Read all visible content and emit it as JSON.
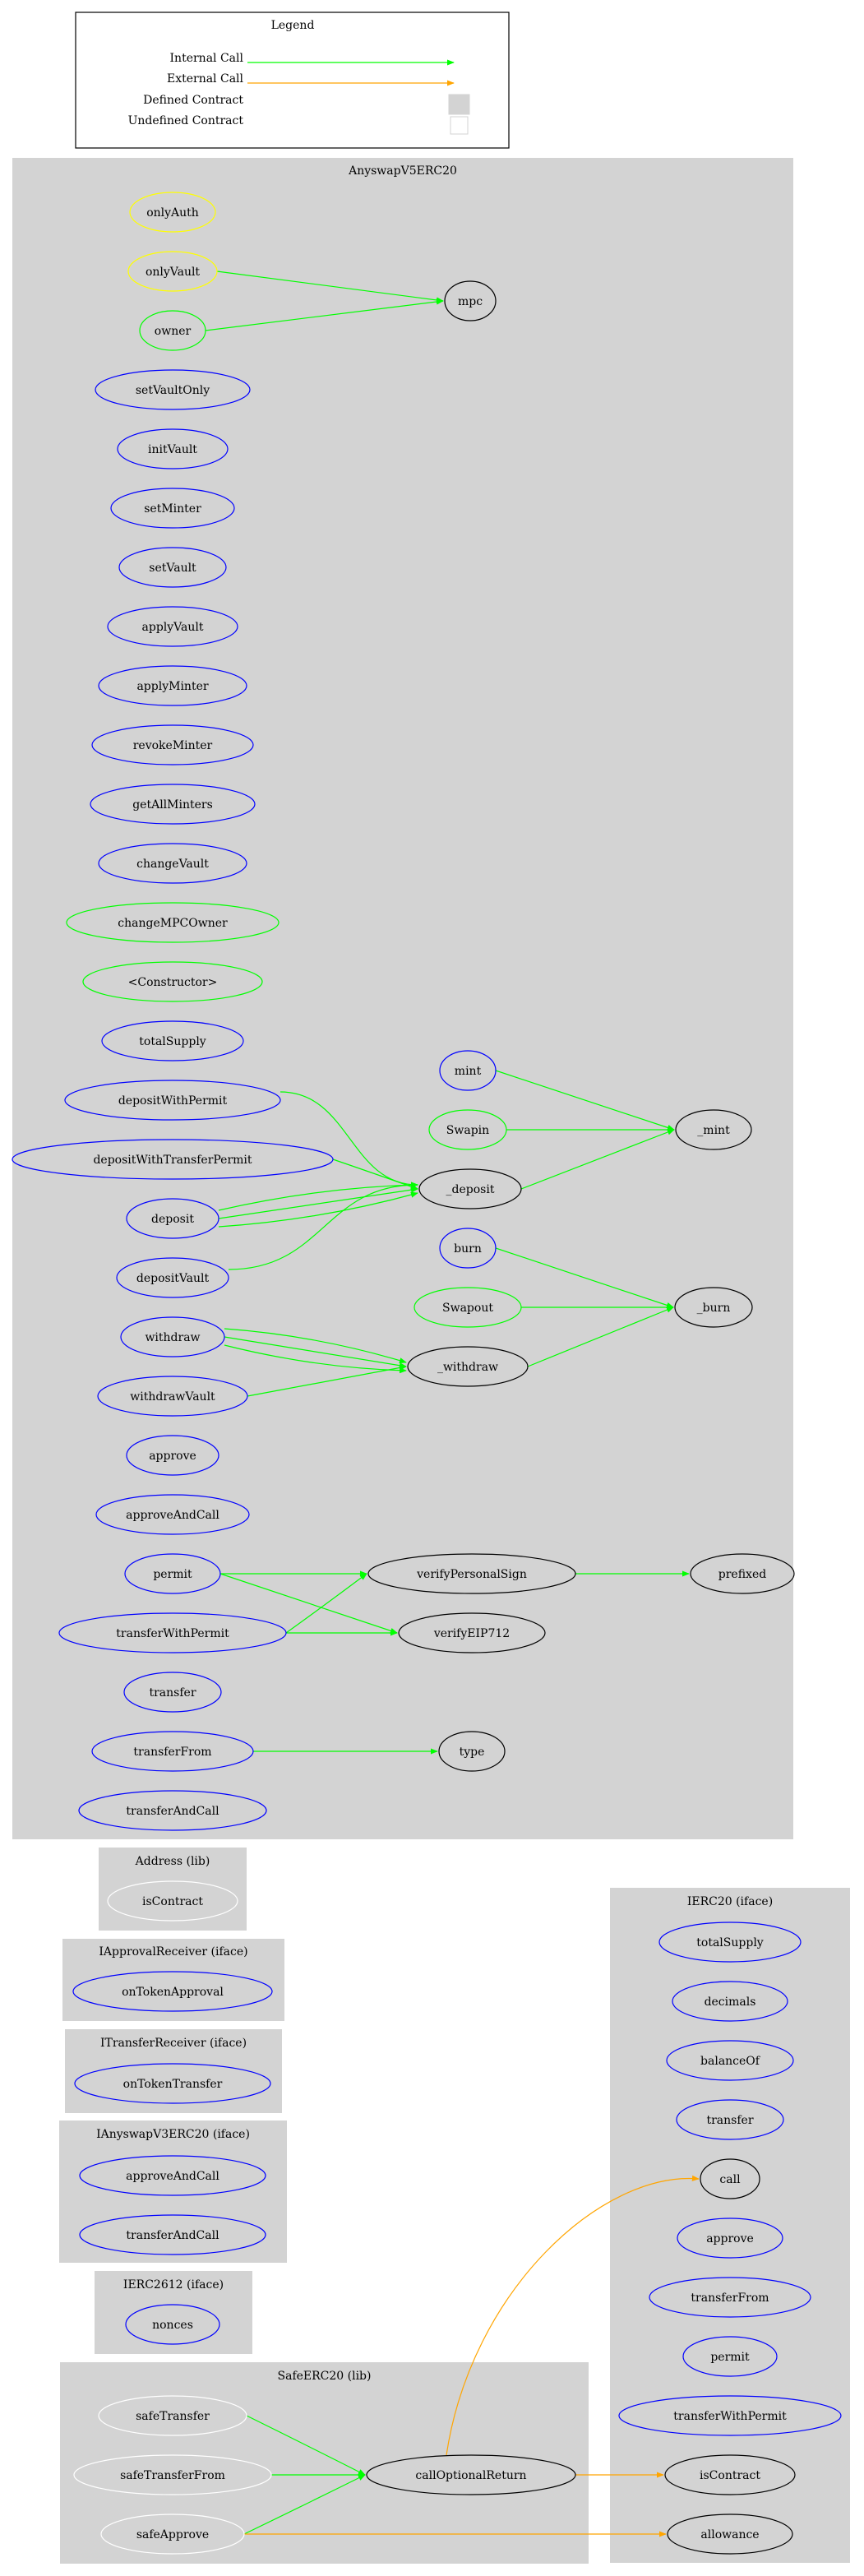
{
  "legend": {
    "title": "Legend",
    "items": [
      {
        "label": "Internal Call",
        "kind": "edge",
        "color": "#00ff00"
      },
      {
        "label": "External Call",
        "kind": "edge",
        "color": "#ffa500"
      },
      {
        "label": "Defined Contract",
        "kind": "swatch",
        "color": "#d3d3d3"
      },
      {
        "label": "Undefined Contract",
        "kind": "swatch",
        "color": "#ffffff"
      }
    ]
  },
  "colors": {
    "internal_call": "#00ff00",
    "external_call": "#ffa500",
    "cluster_fill": "#d3d3d3",
    "public_function": "#0000ff",
    "modifier": "#ffff00",
    "payable_or_special": "#00ff00",
    "internal_function": "#000000",
    "library_function": "#ffffff"
  },
  "clusters": [
    {
      "id": "anyswap",
      "title": "AnyswapV5ERC20",
      "nodes": [
        {
          "id": "onlyAuth",
          "label": "onlyAuth",
          "stroke": "modifier"
        },
        {
          "id": "onlyVault",
          "label": "onlyVault",
          "stroke": "modifier"
        },
        {
          "id": "owner",
          "label": "owner",
          "stroke": "payable_or_special"
        },
        {
          "id": "mpc",
          "label": "mpc",
          "stroke": "internal_function"
        },
        {
          "id": "setVaultOnly",
          "label": "setVaultOnly",
          "stroke": "public_function"
        },
        {
          "id": "initVault",
          "label": "initVault",
          "stroke": "public_function"
        },
        {
          "id": "setMinter",
          "label": "setMinter",
          "stroke": "public_function"
        },
        {
          "id": "setVault",
          "label": "setVault",
          "stroke": "public_function"
        },
        {
          "id": "applyVault",
          "label": "applyVault",
          "stroke": "public_function"
        },
        {
          "id": "applyMinter",
          "label": "applyMinter",
          "stroke": "public_function"
        },
        {
          "id": "revokeMinter",
          "label": "revokeMinter",
          "stroke": "public_function"
        },
        {
          "id": "getAllMinters",
          "label": "getAllMinters",
          "stroke": "public_function"
        },
        {
          "id": "changeVault",
          "label": "changeVault",
          "stroke": "public_function"
        },
        {
          "id": "changeMPCOwner",
          "label": "changeMPCOwner",
          "stroke": "payable_or_special"
        },
        {
          "id": "constructor",
          "label": "<Constructor>",
          "stroke": "payable_or_special"
        },
        {
          "id": "totalSupply",
          "label": "totalSupply",
          "stroke": "public_function"
        },
        {
          "id": "depositWithPermit",
          "label": "depositWithPermit",
          "stroke": "public_function"
        },
        {
          "id": "depositWithTransferPermit",
          "label": "depositWithTransferPermit",
          "stroke": "public_function"
        },
        {
          "id": "deposit",
          "label": "deposit",
          "stroke": "public_function"
        },
        {
          "id": "depositVault",
          "label": "depositVault",
          "stroke": "public_function"
        },
        {
          "id": "withdraw",
          "label": "withdraw",
          "stroke": "public_function"
        },
        {
          "id": "withdrawVault",
          "label": "withdrawVault",
          "stroke": "public_function"
        },
        {
          "id": "approve",
          "label": "approve",
          "stroke": "public_function"
        },
        {
          "id": "approveAndCall",
          "label": "approveAndCall",
          "stroke": "public_function"
        },
        {
          "id": "permit",
          "label": "permit",
          "stroke": "public_function"
        },
        {
          "id": "transferWithPermit",
          "label": "transferWithPermit",
          "stroke": "public_function"
        },
        {
          "id": "transfer",
          "label": "transfer",
          "stroke": "public_function"
        },
        {
          "id": "transferFrom",
          "label": "transferFrom",
          "stroke": "public_function"
        },
        {
          "id": "transferAndCall",
          "label": "transferAndCall",
          "stroke": "public_function"
        },
        {
          "id": "mint",
          "label": "mint",
          "stroke": "public_function"
        },
        {
          "id": "Swapin",
          "label": "Swapin",
          "stroke": "payable_or_special"
        },
        {
          "id": "_deposit",
          "label": "_deposit",
          "stroke": "internal_function"
        },
        {
          "id": "burn",
          "label": "burn",
          "stroke": "public_function"
        },
        {
          "id": "Swapout",
          "label": "Swapout",
          "stroke": "payable_or_special"
        },
        {
          "id": "_withdraw",
          "label": "_withdraw",
          "stroke": "internal_function"
        },
        {
          "id": "_mint",
          "label": "_mint",
          "stroke": "internal_function"
        },
        {
          "id": "_burn",
          "label": "_burn",
          "stroke": "internal_function"
        },
        {
          "id": "verifyPersonalSign",
          "label": "verifyPersonalSign",
          "stroke": "internal_function"
        },
        {
          "id": "verifyEIP712",
          "label": "verifyEIP712",
          "stroke": "internal_function"
        },
        {
          "id": "prefixed",
          "label": "prefixed",
          "stroke": "internal_function"
        },
        {
          "id": "type",
          "label": "type",
          "stroke": "internal_function"
        }
      ]
    },
    {
      "id": "address",
      "title": "Address  (lib)",
      "nodes": [
        {
          "id": "addr_isContract",
          "label": "isContract",
          "stroke": "library_function"
        }
      ]
    },
    {
      "id": "iapproval",
      "title": "IApprovalReceiver  (iface)",
      "nodes": [
        {
          "id": "onTokenApproval",
          "label": "onTokenApproval",
          "stroke": "public_function"
        }
      ]
    },
    {
      "id": "itransfer",
      "title": "ITransferReceiver  (iface)",
      "nodes": [
        {
          "id": "onTokenTransfer",
          "label": "onTokenTransfer",
          "stroke": "public_function"
        }
      ]
    },
    {
      "id": "iv3",
      "title": "IAnyswapV3ERC20  (iface)",
      "nodes": [
        {
          "id": "v3_approveAndCall",
          "label": "approveAndCall",
          "stroke": "public_function"
        },
        {
          "id": "v3_transferAndCall",
          "label": "transferAndCall",
          "stroke": "public_function"
        }
      ]
    },
    {
      "id": "ierc2612",
      "title": "IERC2612  (iface)",
      "nodes": [
        {
          "id": "nonces",
          "label": "nonces",
          "stroke": "public_function"
        }
      ]
    },
    {
      "id": "safeerc20",
      "title": "SafeERC20  (lib)",
      "nodes": [
        {
          "id": "safeTransfer",
          "label": "safeTransfer",
          "stroke": "library_function"
        },
        {
          "id": "safeTransferFrom",
          "label": "safeTransferFrom",
          "stroke": "library_function"
        },
        {
          "id": "safeApprove",
          "label": "safeApprove",
          "stroke": "library_function"
        },
        {
          "id": "callOptionalReturn",
          "label": "callOptionalReturn",
          "stroke": "internal_function"
        }
      ]
    },
    {
      "id": "ierc20",
      "title": "IERC20  (iface)",
      "nodes": [
        {
          "id": "e_totalSupply",
          "label": "totalSupply",
          "stroke": "public_function"
        },
        {
          "id": "e_decimals",
          "label": "decimals",
          "stroke": "public_function"
        },
        {
          "id": "e_balanceOf",
          "label": "balanceOf",
          "stroke": "public_function"
        },
        {
          "id": "e_transfer",
          "label": "transfer",
          "stroke": "public_function"
        },
        {
          "id": "e_call",
          "label": "call",
          "stroke": "internal_function"
        },
        {
          "id": "e_approve",
          "label": "approve",
          "stroke": "public_function"
        },
        {
          "id": "e_transferFrom",
          "label": "transferFrom",
          "stroke": "public_function"
        },
        {
          "id": "e_permit",
          "label": "permit",
          "stroke": "public_function"
        },
        {
          "id": "e_transferWithPermit",
          "label": "transferWithPermit",
          "stroke": "public_function"
        },
        {
          "id": "e_isContract",
          "label": "isContract",
          "stroke": "internal_function"
        },
        {
          "id": "e_allowance",
          "label": "allowance",
          "stroke": "internal_function"
        }
      ]
    }
  ],
  "edges": [
    {
      "from": "onlyVault",
      "to": "mpc",
      "type": "internal"
    },
    {
      "from": "owner",
      "to": "mpc",
      "type": "internal"
    },
    {
      "from": "mint",
      "to": "_mint",
      "type": "internal"
    },
    {
      "from": "Swapin",
      "to": "_mint",
      "type": "internal"
    },
    {
      "from": "_deposit",
      "to": "_mint",
      "type": "internal"
    },
    {
      "from": "depositWithPermit",
      "to": "_deposit",
      "type": "internal"
    },
    {
      "from": "depositWithTransferPermit",
      "to": "_deposit",
      "type": "internal"
    },
    {
      "from": "deposit",
      "to": "_deposit",
      "type": "internal"
    },
    {
      "from": "deposit",
      "to": "_deposit",
      "type": "internal"
    },
    {
      "from": "deposit",
      "to": "_deposit",
      "type": "internal"
    },
    {
      "from": "depositVault",
      "to": "_deposit",
      "type": "internal"
    },
    {
      "from": "burn",
      "to": "_burn",
      "type": "internal"
    },
    {
      "from": "Swapout",
      "to": "_burn",
      "type": "internal"
    },
    {
      "from": "_withdraw",
      "to": "_burn",
      "type": "internal"
    },
    {
      "from": "withdraw",
      "to": "_withdraw",
      "type": "internal"
    },
    {
      "from": "withdraw",
      "to": "_withdraw",
      "type": "internal"
    },
    {
      "from": "withdraw",
      "to": "_withdraw",
      "type": "internal"
    },
    {
      "from": "withdrawVault",
      "to": "_withdraw",
      "type": "internal"
    },
    {
      "from": "permit",
      "to": "verifyPersonalSign",
      "type": "internal"
    },
    {
      "from": "permit",
      "to": "verifyEIP712",
      "type": "internal"
    },
    {
      "from": "transferWithPermit",
      "to": "verifyPersonalSign",
      "type": "internal"
    },
    {
      "from": "transferWithPermit",
      "to": "verifyEIP712",
      "type": "internal"
    },
    {
      "from": "verifyPersonalSign",
      "to": "prefixed",
      "type": "internal"
    },
    {
      "from": "transferFrom",
      "to": "type",
      "type": "internal"
    },
    {
      "from": "safeTransfer",
      "to": "callOptionalReturn",
      "type": "internal"
    },
    {
      "from": "safeTransferFrom",
      "to": "callOptionalReturn",
      "type": "internal"
    },
    {
      "from": "safeApprove",
      "to": "callOptionalReturn",
      "type": "internal"
    },
    {
      "from": "callOptionalReturn",
      "to": "e_call",
      "type": "external"
    },
    {
      "from": "callOptionalReturn",
      "to": "e_isContract",
      "type": "external"
    },
    {
      "from": "safeApprove",
      "to": "e_allowance",
      "type": "external"
    }
  ]
}
